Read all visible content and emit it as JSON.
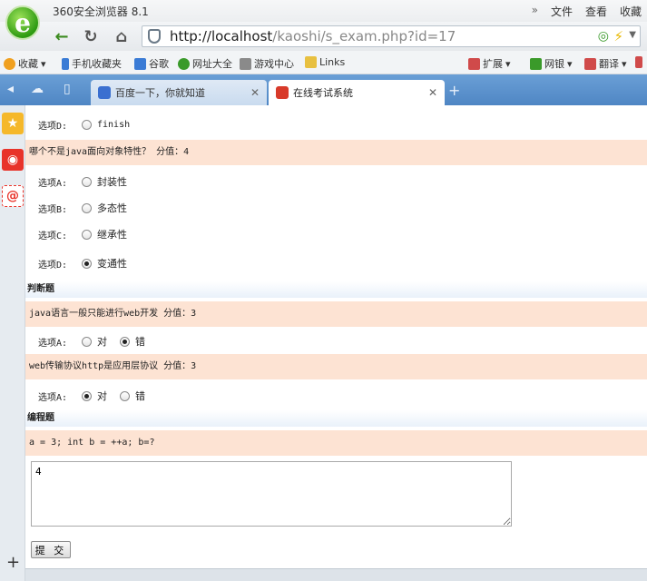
{
  "browser": {
    "app_title": "360安全浏览器 8.1",
    "logo_glyph": "e",
    "menu": [
      "文件",
      "查看",
      "收藏"
    ],
    "menu_chevron": "»",
    "address": {
      "host": "http://localhost",
      "path": "/kaoshi/s_exam.php?id=17"
    },
    "bookmarks": [
      {
        "label": "收藏",
        "color": "#f0a020"
      },
      {
        "label": "手机收藏夹",
        "color": "#3a7bd5"
      },
      {
        "label": "谷歌",
        "color": "#3a7bd5"
      },
      {
        "label": "网址大全",
        "color": "#3a9a2a"
      },
      {
        "label": "游戏中心",
        "color": "#8a8a8a"
      },
      {
        "label": "Links",
        "color": "#e8c040"
      }
    ],
    "bookmarks_right": [
      {
        "label": "扩展",
        "color": "#d04a4a"
      },
      {
        "label": "网银",
        "color": "#3a9a2a"
      },
      {
        "label": "翻译",
        "color": "#d04a4a"
      }
    ],
    "tabs": [
      {
        "title": "百度一下，你就知道",
        "active": false,
        "icon_color": "#3a6fd0"
      },
      {
        "title": "在线考试系统",
        "active": true,
        "icon_color": "#d83a2a"
      }
    ],
    "accent": "#5a93cf"
  },
  "exam": {
    "prev_option": {
      "label": "选项D:",
      "text": "finish",
      "checked": false
    },
    "q1": {
      "prompt": "哪个不是java面向对象特性？ 分值：4",
      "options": [
        {
          "label": "选项A:",
          "text": "封装性",
          "checked": false
        },
        {
          "label": "选项B:",
          "text": "多态性",
          "checked": false
        },
        {
          "label": "选项C:",
          "text": "继承性",
          "checked": false
        },
        {
          "label": "选项D:",
          "text": "变通性",
          "checked": true
        }
      ]
    },
    "section_judge": "判断题",
    "q2": {
      "prompt": "java语言一般只能进行web开发 分值：3",
      "label": "选项A:",
      "choices": [
        {
          "text": "对",
          "checked": false
        },
        {
          "text": "错",
          "checked": true
        }
      ]
    },
    "q3": {
      "prompt": "web传输协议http是应用层协议 分值：3",
      "label": "选项A:",
      "choices": [
        {
          "text": "对",
          "checked": true
        },
        {
          "text": "错",
          "checked": false
        }
      ]
    },
    "section_code": "编程题",
    "q4": {
      "prompt": "a = 3; int b = ++a; b=?",
      "answer": "4"
    },
    "submit_label": "提 交"
  }
}
